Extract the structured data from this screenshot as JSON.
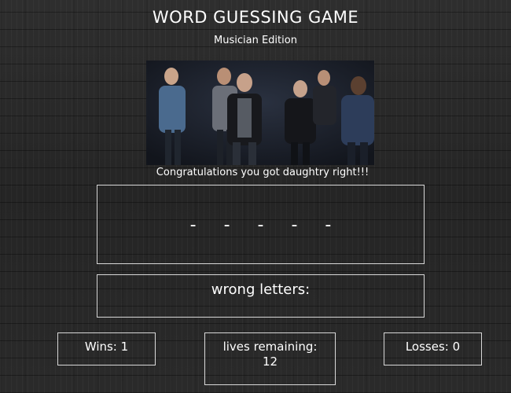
{
  "header": {
    "title": "WORD GUESSING GAME",
    "subtitle": "Musician Edition"
  },
  "photo": {
    "subject": "daughtry band photo"
  },
  "message": "Congratulations you got daughtry right!!!",
  "word": {
    "blanks": "- - - - -"
  },
  "wrong_letters": {
    "label": "wrong letters:",
    "value": ""
  },
  "stats": {
    "wins_label": "Wins: 1",
    "lives_label": "lives remaining:",
    "lives_value": "12",
    "losses_label": "Losses: 0"
  }
}
